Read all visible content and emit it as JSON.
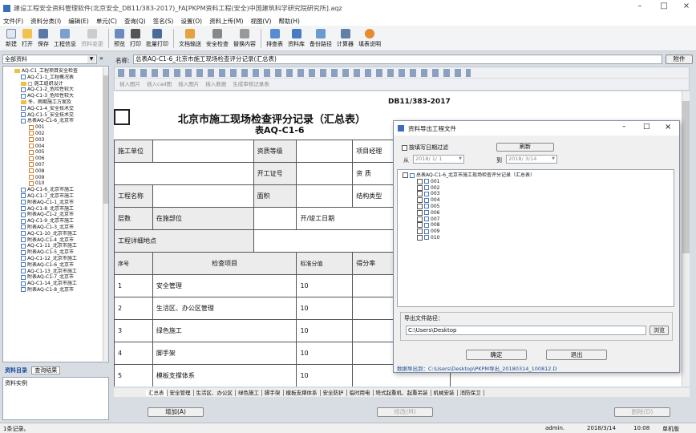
{
  "app": {
    "title": "建设工程安全资料管理软件(北京安全_DB11/383-2017)_FA[PKPM资料工程(安全)中国建筑科学研究院研究所].aqz"
  },
  "menu": [
    "文件(F)",
    "资料分类(I)",
    "编辑(E)",
    "单元(C)",
    "查询(Q)",
    "签名(S)",
    "设置(O)",
    "资料上传(M)",
    "视图(V)",
    "帮助(H)"
  ],
  "toolbar": [
    "新建",
    "打开",
    "保存",
    "工程信息",
    "资料变更",
    "预览",
    "打印",
    "批量打印",
    "文档输送",
    "安全检查",
    "替换内容",
    "排查表",
    "资料库",
    "备份路径",
    "计算器",
    "填表说明"
  ],
  "left": {
    "combo": "全部资料",
    "tabs": [
      "资料目录",
      "查询结果"
    ],
    "detail_label": "资料实例",
    "tree": [
      "AQ-C1_工程项目安全检查",
      "AQ-C1-1_工程概况表",
      "□ 施工组织设计",
      "AQ-C1-2_危险性较大",
      "AQ-C1-3_危险性较大",
      "冬、雨期施工方案及",
      "AQ-C1-4_安全技术交",
      "AQ-C1-5_安全技术交",
      "总表AQ-C1-6_北京市",
      "001",
      "002",
      "003",
      "004",
      "005",
      "006",
      "007",
      "008",
      "009",
      "010",
      "AQ-C1-6_北京市施工",
      "AQ-C1-7_北京市施工",
      "附表AQ-C1-1_北京市",
      "AQ-C1-8_北京市施工",
      "附表AQ-C1-2_北京市",
      "AQ-C1-9_北京市施工",
      "附表AQ-C1-3_北京市",
      "AQ-C1-10_北京市施工",
      "附表AQ-C1-4_北京市",
      "AQ-C1-11_北京市施工",
      "附表AQ-C1-5_北京市",
      "AQ-C1-12_北京市施工",
      "附表AQ-C1-6_北京市",
      "AQ-C1-13_北京市施工",
      "附表AQ-C1-7_北京市",
      "AQ-C1-14_北京市施工",
      "附表AQ-C1-8_北京市"
    ]
  },
  "form": {
    "name_label": "名称:",
    "name_value": "总表AQ-C1-6_北京市施工现场检查评分记录(汇总表)",
    "attach": "附件"
  },
  "sheet_toolbar": [
    "插入图片",
    "插入cad图",
    "插入图片",
    "插入数据",
    "生成审核记录表"
  ],
  "sheet": {
    "std": "DB11/383-2017",
    "title1": "北京市施工现场检查评分记录（汇总表）",
    "title2": "表AQ-C1-6",
    "r1": [
      "施工单位",
      "资质等级",
      "项目经理"
    ],
    "r2": [
      "开工证号",
      "资  质"
    ],
    "r3": [
      "工程名称",
      "面积",
      "结构类型"
    ],
    "r4": [
      "层数",
      "在施部位",
      "开/竣工日期"
    ],
    "r5": [
      "工程详细地点"
    ],
    "head": [
      "序号",
      "检查项目",
      "标准分值",
      "得分率"
    ],
    "rows": [
      [
        "1",
        "安全管理",
        "10"
      ],
      [
        "2",
        "生活区、办公区管理",
        "10"
      ],
      [
        "3",
        "绿色施工",
        "10"
      ],
      [
        "4",
        "脚手架",
        "10"
      ],
      [
        "5",
        "模板支撑体系",
        "10"
      ]
    ]
  },
  "sheet_tabs": [
    "汇总表",
    "安全管理",
    "生活区、办公区",
    "绿色施工",
    "脚手架",
    "模板支撑体系",
    "安全防护",
    "临时用电",
    "塔式起重机、起重吊装",
    "机械安装",
    "消防保卫"
  ],
  "bottom": {
    "add": "增加(A)",
    "mid": "修改(M)",
    "del": "删除(D)"
  },
  "status": {
    "left": "1条记录。",
    "user": "admin.",
    "date": "2018/3/14",
    "time": "10:08",
    "mode": "单机版"
  },
  "dialog": {
    "title": "资料导出工程文件",
    "filter_check": "按填写日期过滤",
    "filter_btn": "刷新",
    "from_label": "从",
    "from": "2018/ 1/ 1",
    "to_label": "到",
    "to": "2018/ 3/14",
    "root": "总表AQ-C1-6_北京市施工现场检查评分记录（汇总表）",
    "items": [
      "001",
      "002",
      "003",
      "004",
      "005",
      "006",
      "007",
      "008",
      "009",
      "010"
    ],
    "path_label": "导出文件路径：",
    "path": "C:\\Users\\Desktop",
    "browse": "浏览",
    "ok": "确定",
    "cancel": "退出",
    "result": "数据导出到：C:\\Users\\Desktop\\PKPM导出_20180314_100812.D"
  }
}
